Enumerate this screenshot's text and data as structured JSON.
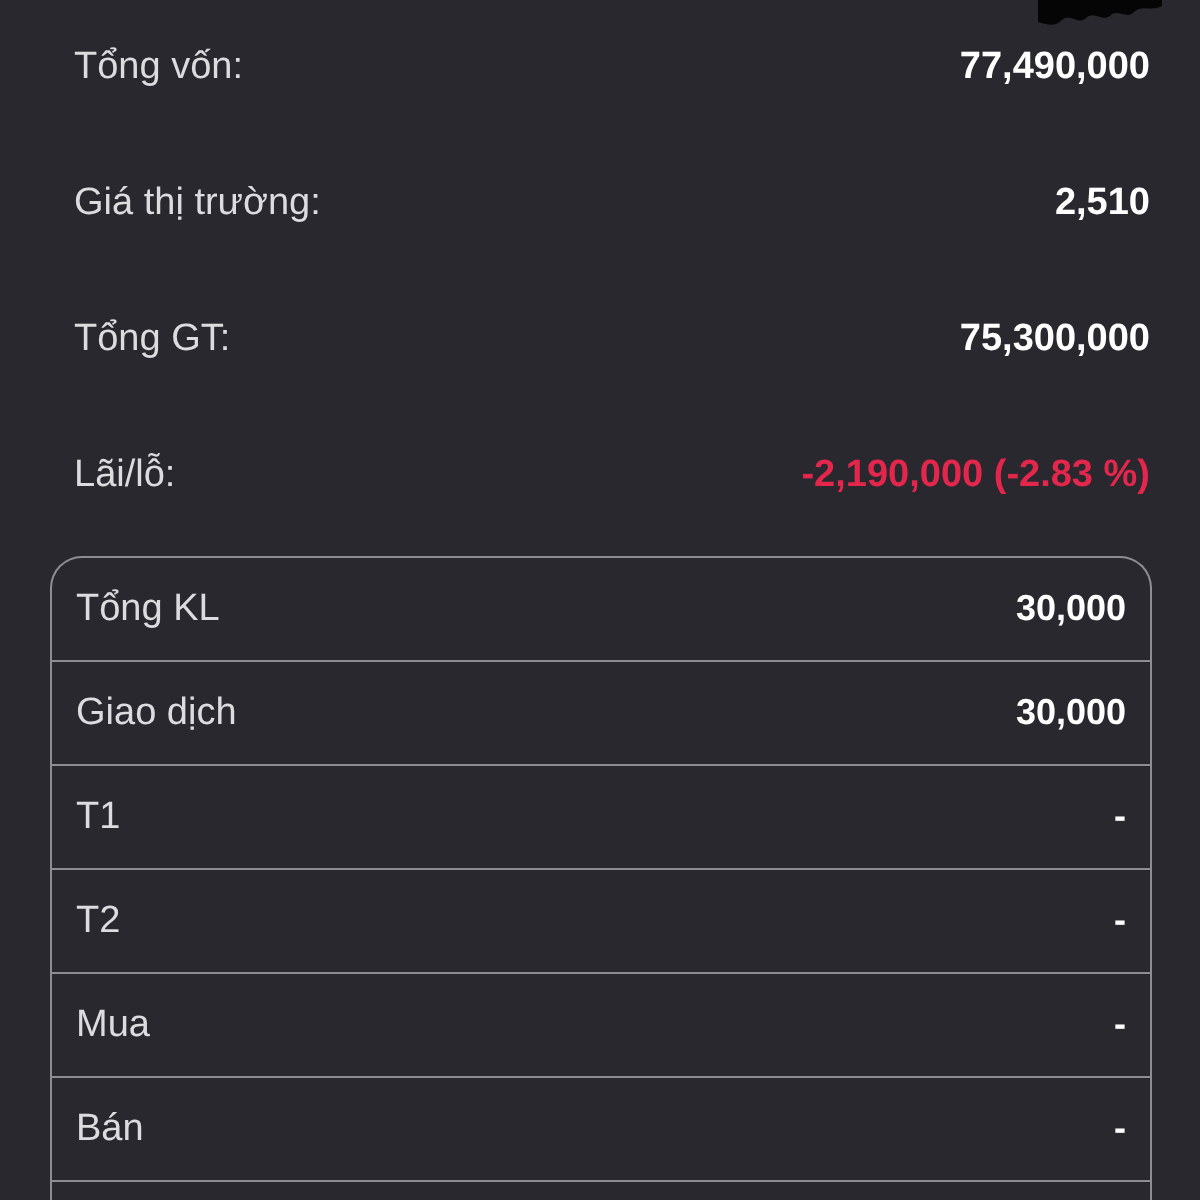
{
  "summary": [
    {
      "label": "Tổng vốn:",
      "value": "77,490,000",
      "negative": false
    },
    {
      "label": "Giá thị trường:",
      "value": "2,510",
      "negative": false
    },
    {
      "label": "Tổng GT:",
      "value": "75,300,000",
      "negative": false
    },
    {
      "label": "Lãi/lỗ:",
      "value": "-2,190,000 (-2.83 %)",
      "negative": true
    }
  ],
  "volume_table": {
    "rows": [
      {
        "label": "Tổng KL",
        "value": "30,000"
      },
      {
        "label": "Giao dịch",
        "value": "30,000"
      },
      {
        "label": "T1",
        "value": "-"
      },
      {
        "label": "T2",
        "value": "-"
      },
      {
        "label": "Mua",
        "value": "-"
      },
      {
        "label": "Bán",
        "value": "-"
      }
    ]
  }
}
